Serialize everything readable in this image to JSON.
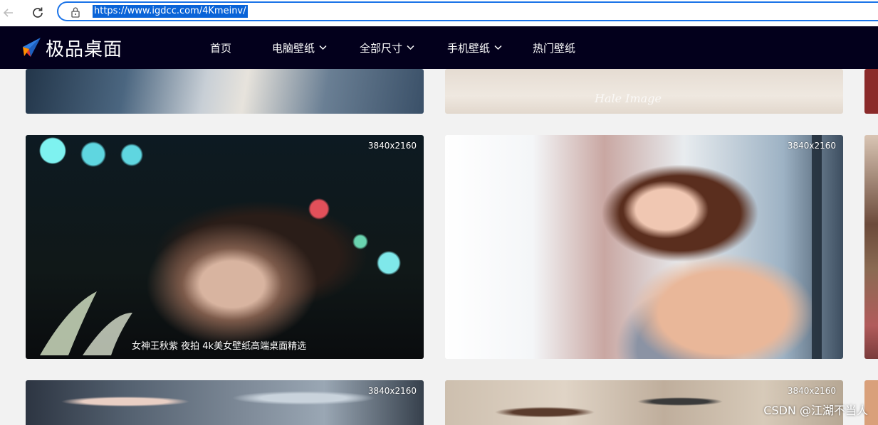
{
  "browser": {
    "url": "https://www.igdcc.com/4Kmeinv/"
  },
  "site": {
    "logo_text": "极品桌面",
    "menu": [
      {
        "label": "首页",
        "has_dropdown": false
      },
      {
        "label": "电脑壁纸",
        "has_dropdown": true
      },
      {
        "label": "全部尺寸",
        "has_dropdown": true
      },
      {
        "label": "手机壁纸",
        "has_dropdown": true
      },
      {
        "label": "热门壁纸",
        "has_dropdown": false
      }
    ]
  },
  "tiles": {
    "row1": [
      {
        "resolution": "3840x2160",
        "caption": "女神王秋紫 夜拍 4k美女壁纸高端桌面精选"
      },
      {
        "resolution": "3840x2160"
      }
    ],
    "row2": [
      {
        "resolution": "3840x2160"
      },
      {
        "resolution": "3840x2160"
      }
    ],
    "top_signature": "Hale Image"
  },
  "overlay": {
    "watermark": "CSDN @江湖不当人"
  },
  "colors": {
    "header_bg": "#03001c",
    "page_bg": "#f2f2f2",
    "url_highlight": "#0a64d8",
    "address_border": "#1a73e8"
  }
}
